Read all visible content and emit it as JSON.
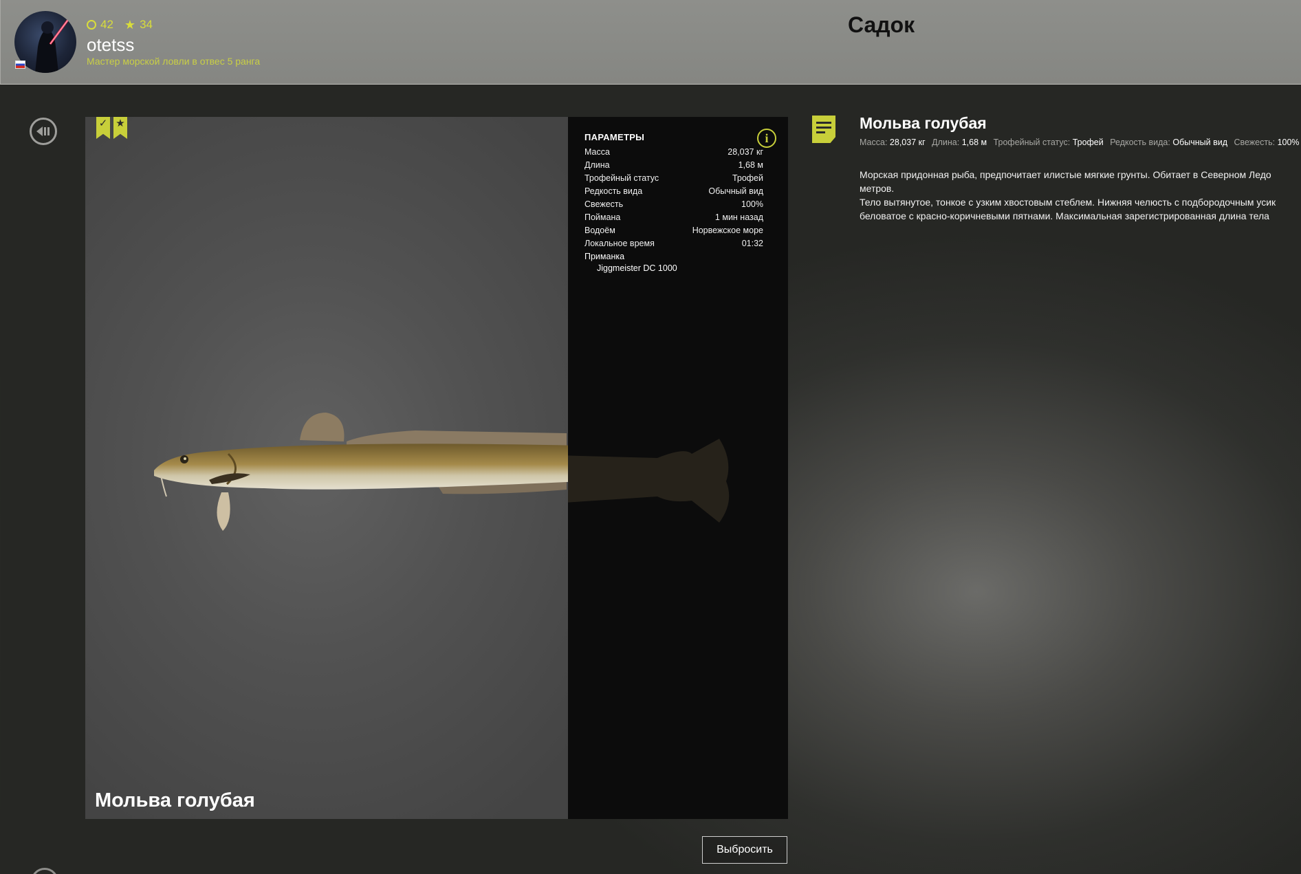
{
  "header": {
    "player": {
      "level": "42",
      "stars": "34",
      "username": "otetss",
      "rank_title": "Мастер морской ловли в отвес 5 ранга"
    },
    "title": "Садок"
  },
  "viewer": {
    "fish_name": "Мольва голубая",
    "badges": [
      "checkmark-icon",
      "star-icon"
    ]
  },
  "params": {
    "title": "ПАРАМЕТРЫ",
    "rows": [
      {
        "label": "Масса",
        "value": "28,037 кг"
      },
      {
        "label": "Длина",
        "value": "1,68 м"
      },
      {
        "label": "Трофейный статус",
        "value": "Трофей"
      },
      {
        "label": "Редкость вида",
        "value": "Обычный вид"
      },
      {
        "label": "Свежесть",
        "value": "100%"
      },
      {
        "label": "Поймана",
        "value": "1 мин назад"
      },
      {
        "label": "Водоём",
        "value": "Норвежское море"
      },
      {
        "label": "Локальное время",
        "value": "01:32"
      }
    ],
    "lure_label": "Приманка",
    "lure_value": "Jiggmeister DC 1000"
  },
  "actions": {
    "discard_label": "Выбросить"
  },
  "description": {
    "title": "Мольва голубая",
    "meta": [
      {
        "key": "Масса:",
        "value": "28,037 кг"
      },
      {
        "key": "Длина:",
        "value": "1,68 м"
      },
      {
        "key": "Трофейный статус:",
        "value": "Трофей"
      },
      {
        "key": "Редкость вида:",
        "value": "Обычный вид"
      },
      {
        "key": "Свежесть:",
        "value": "100%"
      }
    ],
    "lines": [
      "Морская придонная рыба, предпочитает илистые мягкие грунты. Обитает в Северном Ледо",
      "метров.",
      "Тело вытянутое, тонкое с узким хвостовым стеблем. Нижняя челюсть с подбородочным усик",
      "беловатое с красно-коричневыми пятнами. Максимальная зарегистрированная длина тела"
    ]
  },
  "colors": {
    "accent": "#c8cf3a",
    "header_bg": "#8e8f8b",
    "panel_bg": "#0c0c0c"
  }
}
